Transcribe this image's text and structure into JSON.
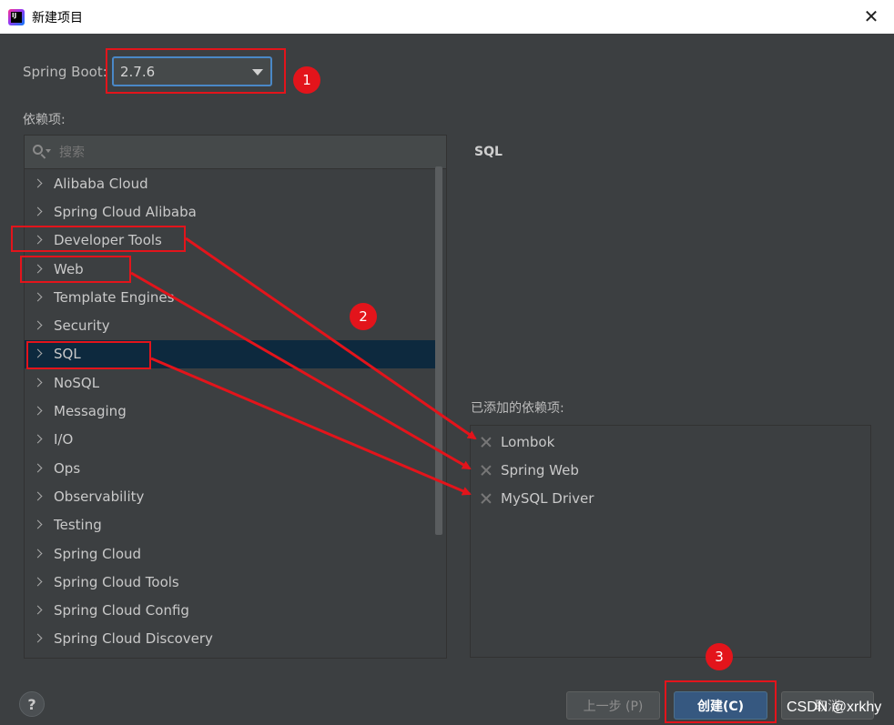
{
  "window": {
    "title": "新建项目",
    "close_symbol": "✕"
  },
  "spring_boot": {
    "label": "Spring Boot:",
    "version": "2.7.6"
  },
  "dependencies": {
    "label": "依赖项:",
    "search_placeholder": "搜索",
    "categories": [
      "Alibaba Cloud",
      "Spring Cloud Alibaba",
      "Developer Tools",
      "Web",
      "Template Engines",
      "Security",
      "SQL",
      "NoSQL",
      "Messaging",
      "I/O",
      "Ops",
      "Observability",
      "Testing",
      "Spring Cloud",
      "Spring Cloud Tools",
      "Spring Cloud Config",
      "Spring Cloud Discovery"
    ],
    "selected": "SQL"
  },
  "detail": {
    "title": "SQL"
  },
  "added": {
    "label": "已添加的依赖项:",
    "items": [
      "Lombok",
      "Spring Web",
      "MySQL Driver"
    ]
  },
  "footer": {
    "help": "?",
    "prev": "上一步 (P)",
    "create": "创建(C)",
    "cancel": "取消"
  },
  "annotations": {
    "badge_1": "1",
    "badge_2": "2",
    "badge_3": "3",
    "color": "#e3141b"
  },
  "watermark": "CSDN @xrkhy"
}
